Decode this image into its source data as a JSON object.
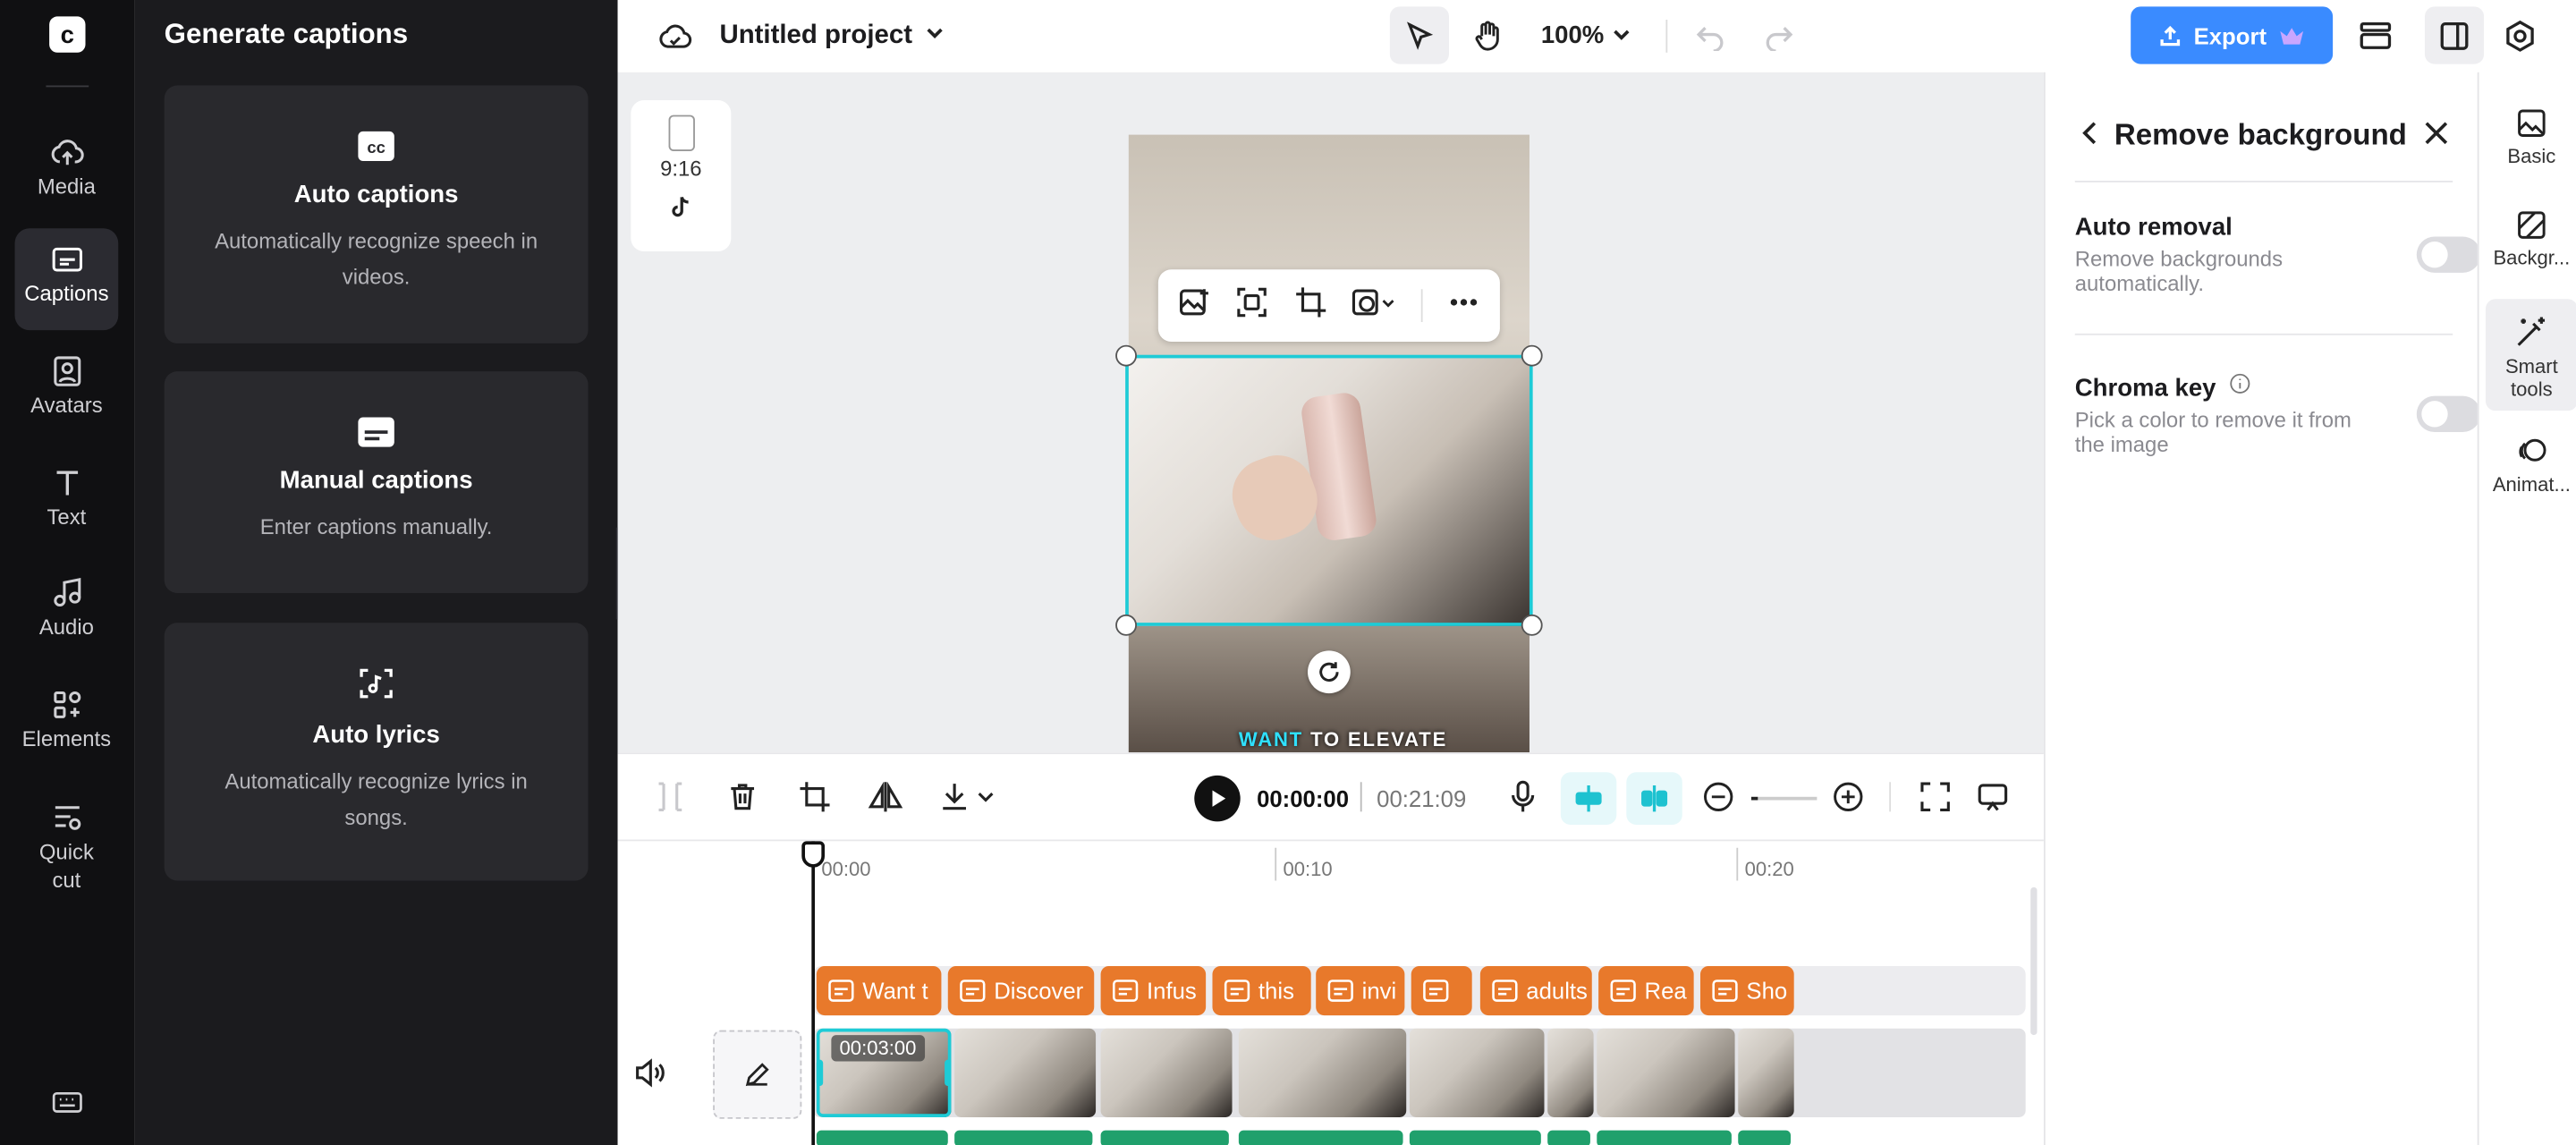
{
  "left_nav": {
    "items": [
      {
        "label": "Media",
        "icon": "cloud-upload-icon"
      },
      {
        "label": "Captions",
        "icon": "captions-icon",
        "active": true
      },
      {
        "label": "Avatars",
        "icon": "avatar-icon"
      },
      {
        "label": "Text",
        "icon": "text-icon"
      },
      {
        "label": "Audio",
        "icon": "music-note-icon"
      },
      {
        "label": "Elements",
        "icon": "elements-icon"
      },
      {
        "label": "Quick cut",
        "icon": "quick-cut-icon"
      }
    ]
  },
  "captions_panel": {
    "title": "Generate captions",
    "cards": [
      {
        "title": "Auto captions",
        "desc": "Automatically recognize speech in videos.",
        "icon": "cc-icon"
      },
      {
        "title": "Manual captions",
        "desc": "Enter captions manually.",
        "icon": "subtitle-icon"
      },
      {
        "title": "Auto lyrics",
        "desc": "Automatically recognize lyrics in songs.",
        "icon": "lyrics-icon"
      }
    ]
  },
  "header": {
    "project_name": "Untitled project",
    "zoom": "100%",
    "export_label": "Export"
  },
  "canvas": {
    "aspect_ratio": "9:16",
    "caption_highlight": "WANT",
    "caption_rest": " TO ELEVATE"
  },
  "right_panel": {
    "title": "Remove background",
    "options": [
      {
        "title": "Auto removal",
        "desc": "Remove backgrounds automatically.",
        "enabled": false
      },
      {
        "title": "Chroma key",
        "desc": "Pick a color to remove it from the image",
        "enabled": false
      }
    ]
  },
  "right_tabs": [
    {
      "label": "Basic",
      "icon": "image-icon"
    },
    {
      "label": "Backgr...",
      "icon": "background-icon"
    },
    {
      "label": "Smart tools",
      "icon": "magic-wand-icon",
      "active": true
    },
    {
      "label": "Animat...",
      "icon": "animation-icon"
    }
  ],
  "player": {
    "current_time": "00:00:00",
    "total_time": "00:21:09"
  },
  "timeline": {
    "ticks": [
      "00:00",
      "00:10",
      "00:20"
    ],
    "selected_clip_duration": "00:03:00",
    "caption_chips": [
      "Want t",
      "Discover",
      "Infus",
      "this",
      "invi",
      "",
      "adults",
      "Rea",
      "Sho"
    ]
  },
  "colors": {
    "accent": "#3a8bff",
    "selection": "#1ecbd6",
    "caption_chip": "#e8792b"
  }
}
